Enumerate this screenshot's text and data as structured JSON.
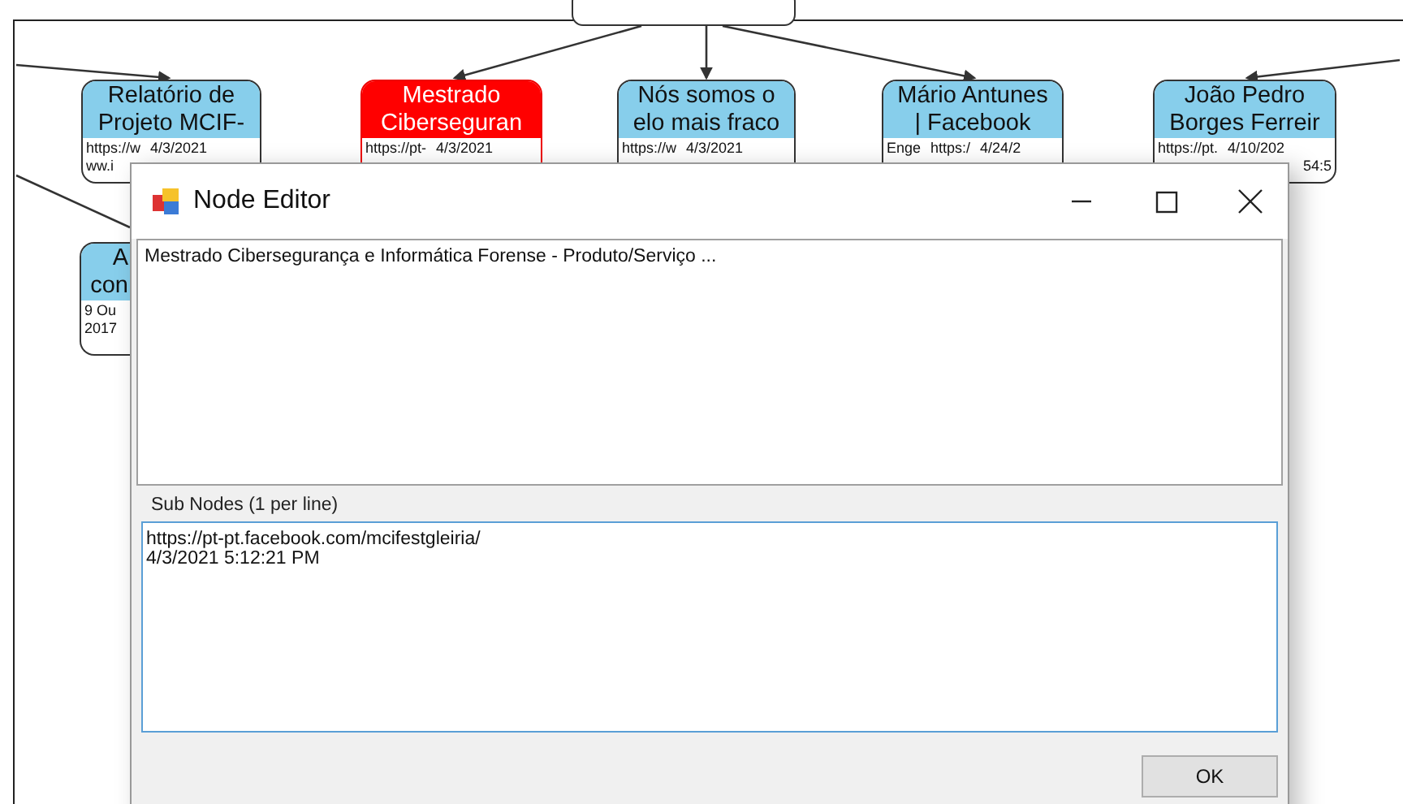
{
  "canvas": {
    "nodes": [
      {
        "title": [
          "Relatório de",
          "Projeto MCIF-"
        ],
        "details": [
          [
            "https://w",
            "4/3/2021"
          ],
          [
            "ww.i"
          ]
        ],
        "selected": false,
        "partial": false
      },
      {
        "title": [
          "Mestrado",
          "Ciberseguran"
        ],
        "details": [
          [
            "https://pt-",
            "4/3/2021"
          ]
        ],
        "selected": true,
        "partial": false
      },
      {
        "title": [
          "Nós somos o",
          "elo mais fraco"
        ],
        "details": [
          [
            "https://w",
            "4/3/2021"
          ]
        ],
        "selected": false,
        "partial": false
      },
      {
        "title": [
          "Mário Antunes",
          "| Facebook"
        ],
        "details": [
          [
            "Enge",
            "https:/",
            "4/24/2"
          ]
        ],
        "selected": false,
        "partial": false
      },
      {
        "title": [
          "João Pedro",
          "Borges Ferreir"
        ],
        "details": [
          [
            "https://pt.",
            "4/10/202"
          ],
          {
            "kind": "end",
            "parts": [
              "54:5"
            ]
          }
        ],
        "selected": false,
        "partial": false
      },
      {
        "title": [
          "A",
          "con"
        ],
        "details": [
          [
            "9 Ou"
          ],
          [
            "2017"
          ]
        ],
        "selected": false,
        "partial": true
      }
    ]
  },
  "dialog": {
    "title": "Node Editor",
    "description": "Mestrado Cibersegurança e Informática Forense - Produto/Serviço ...",
    "sub_nodes": {
      "label": "Sub Nodes (1 per line)",
      "value": "https://pt-pt.facebook.com/mcifestgleiria/\n4/3/2021 5:12:21 PM"
    },
    "buttons": [
      "OK"
    ]
  }
}
